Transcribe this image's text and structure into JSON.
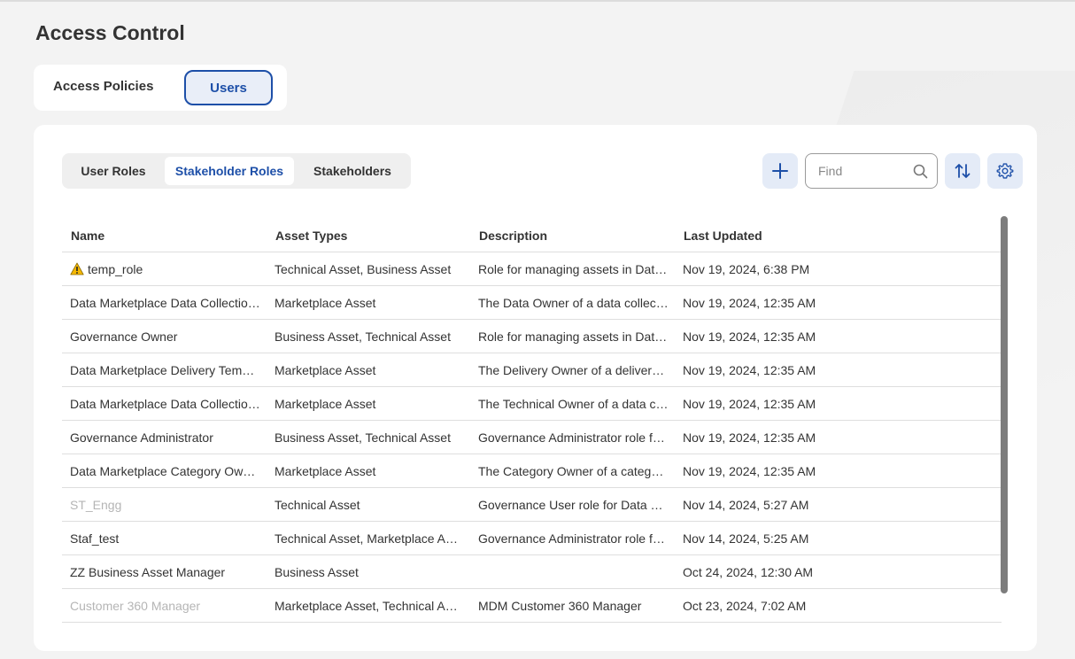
{
  "page": {
    "title": "Access Control"
  },
  "main_tabs": [
    {
      "label": "Access Policies"
    },
    {
      "label": "Users"
    }
  ],
  "sub_tabs": [
    {
      "label": "User Roles"
    },
    {
      "label": "Stakeholder Roles"
    },
    {
      "label": "Stakeholders"
    }
  ],
  "toolbar": {
    "add_icon": "plus-icon",
    "find_placeholder": "Find",
    "search_icon": "search-icon",
    "sort_icon": "sort-icon",
    "settings_icon": "gear-icon"
  },
  "table": {
    "columns": [
      "Name",
      "Asset Types",
      "Description",
      "Last Updated"
    ],
    "rows": [
      {
        "name": "temp_role",
        "warning": true,
        "asset_types": "Technical Asset, Business Asset",
        "description": "Role for managing assets in Dat…",
        "last_updated": "Nov 19, 2024, 6:38 PM"
      },
      {
        "name": "Data Marketplace Data Collectio…",
        "asset_types": "Marketplace Asset",
        "description": "The Data Owner of a data collec…",
        "last_updated": "Nov 19, 2024, 12:35 AM"
      },
      {
        "name": "Governance Owner",
        "asset_types": "Business Asset, Technical Asset",
        "description": "Role for managing assets in Dat…",
        "last_updated": "Nov 19, 2024, 12:35 AM"
      },
      {
        "name": "Data Marketplace Delivery Tem…",
        "asset_types": "Marketplace Asset",
        "description": "The Delivery Owner of a delivery…",
        "last_updated": "Nov 19, 2024, 12:35 AM"
      },
      {
        "name": "Data Marketplace Data Collectio…",
        "asset_types": "Marketplace Asset",
        "description": "The Technical Owner of a data c…",
        "last_updated": "Nov 19, 2024, 12:35 AM"
      },
      {
        "name": "Governance Administrator",
        "asset_types": "Business Asset, Technical Asset",
        "description": "Governance Administrator role f…",
        "last_updated": "Nov 19, 2024, 12:35 AM"
      },
      {
        "name": "Data Marketplace Category Ow…",
        "asset_types": "Marketplace Asset",
        "description": "The Category Owner of a catego…",
        "last_updated": "Nov 19, 2024, 12:35 AM"
      },
      {
        "name": "ST_Engg",
        "dimmed": true,
        "asset_types": "Technical Asset",
        "description": "Governance User role for Data G…",
        "last_updated": "Nov 14, 2024, 5:27 AM"
      },
      {
        "name": "Staf_test",
        "asset_types": "Technical Asset, Marketplace A…",
        "description": "Governance Administrator role f…",
        "last_updated": "Nov 14, 2024, 5:25 AM"
      },
      {
        "name": "ZZ Business Asset Manager",
        "asset_types": "Business Asset",
        "description": "",
        "last_updated": "Oct 24, 2024, 12:30 AM"
      },
      {
        "name": "Customer 360 Manager",
        "dimmed": true,
        "asset_types": "Marketplace Asset, Technical A…",
        "description": "MDM Customer 360 Manager",
        "last_updated": "Oct 23, 2024, 7:02 AM"
      }
    ]
  },
  "colors": {
    "accent": "#1d4fa8",
    "accent_bg": "#e4ebf7",
    "warning": "#f5b800",
    "dimmed_text": "#b5b5b5"
  }
}
